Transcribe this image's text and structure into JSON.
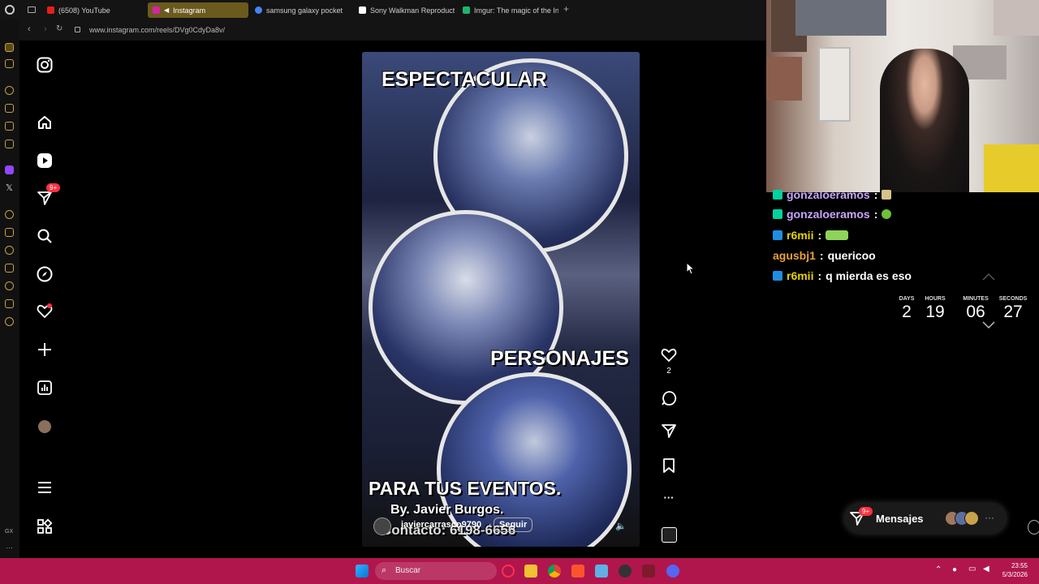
{
  "browser": {
    "tabs": [
      {
        "label": "(6508) YouTube",
        "color": "#e62117"
      },
      {
        "label": "Instagram",
        "color": "#d6249f"
      },
      {
        "label": "samsung galaxy pocket",
        "color": "#4285f4"
      },
      {
        "label": "Sony Walkman Reproduct",
        "color": "#ffffff"
      },
      {
        "label": "Imgur: The magic of the In",
        "color": "#1bb76e"
      }
    ],
    "new_tab_label": "+",
    "url": "www.instagram.com/reels/DVg0CdyDa8v/"
  },
  "instagram": {
    "notification_badge": "9+",
    "reel": {
      "title_top": "ESPECTACULAR",
      "title_mid": "PERSONAJES",
      "title_bottom": "PARA TUS EVENTOS.",
      "credit": "By. Javier Burgos.",
      "contact": "Contacto: 6198-6656",
      "username": "javiercarrasco9790",
      "separator": "·",
      "follow_label": "Seguir"
    },
    "like_count": "2",
    "more_label": "···"
  },
  "chat": {
    "messages": [
      {
        "user": "gonzaloeramos",
        "sep": ":",
        "text": "",
        "user_color": "#c9a6ff",
        "badge": "#00d2a0"
      },
      {
        "user": "gonzaloeramos",
        "sep": ":",
        "text": "",
        "user_color": "#c9a6ff",
        "badge": "#00d2a0"
      },
      {
        "user": "r6mii",
        "sep": ":",
        "text": "",
        "user_color": "#e7d10a",
        "badge": "#1e8fe0"
      },
      {
        "user": "agusbj1",
        "sep": ":",
        "text": "quericoo",
        "user_color": "#e8a03c",
        "badge": ""
      },
      {
        "user": "r6mii",
        "sep": ":",
        "text": "q mierda es eso",
        "user_color": "#e7d10a",
        "badge": "#1e8fe0"
      }
    ]
  },
  "countdown": {
    "days_label": "DAYS",
    "days": "2",
    "hours_label": "HOURS",
    "hours": "19",
    "minutes_label": "MINUTES",
    "minutes": "06",
    "seconds_label": "SECONDS",
    "seconds": "27"
  },
  "messages_pill": {
    "label": "Mensajes",
    "badge": "9+"
  },
  "taskbar": {
    "search_label": "Buscar",
    "time": "23:55",
    "date": "5/3/2026"
  }
}
